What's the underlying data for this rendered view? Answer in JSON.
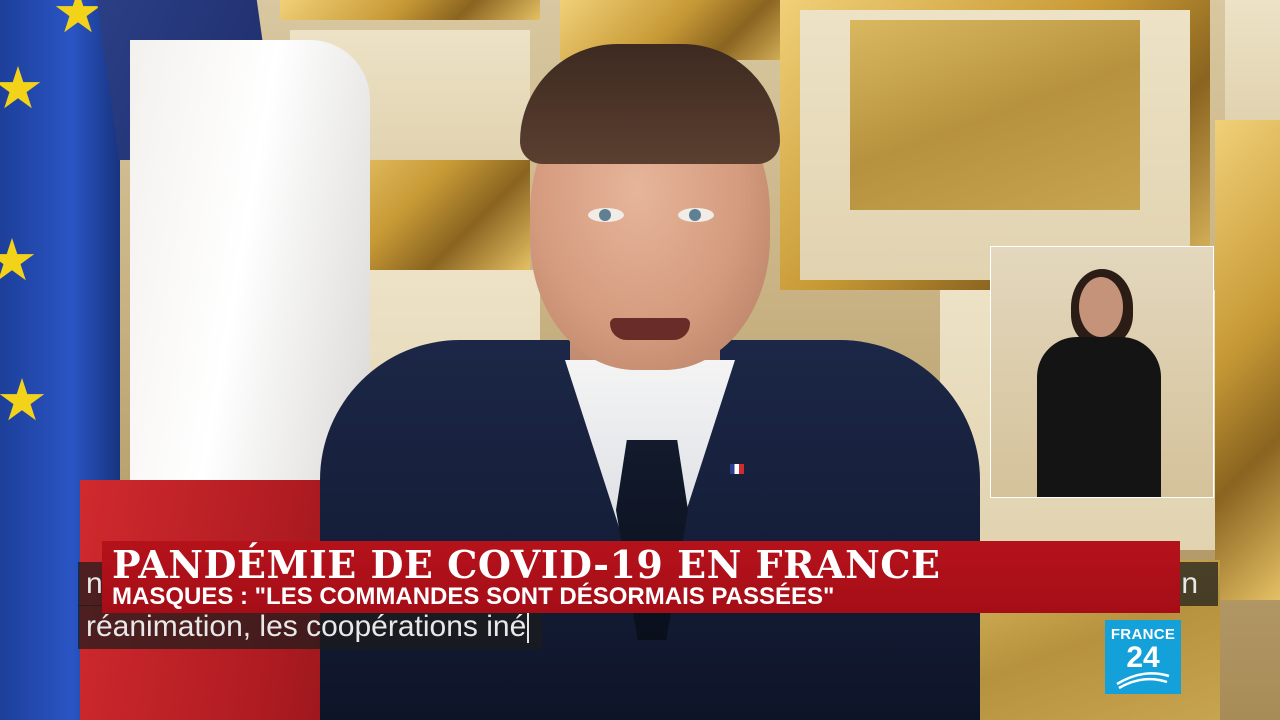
{
  "lower_third": {
    "headline": "PANDÉMIE DE COVID-19 EN FRANCE",
    "subheadline": "MASQUES : \"LES COMMANDES SONT DÉSORMAIS PASSÉES\""
  },
  "subtitles": {
    "line1": "n",
    "line1_end": "n",
    "line2": "réanimation, les coopérations iné"
  },
  "logo": {
    "top": "FRANCE",
    "number": "24"
  },
  "colors": {
    "banner_red": "#b5121b",
    "logo_blue": "#14a0d8"
  }
}
